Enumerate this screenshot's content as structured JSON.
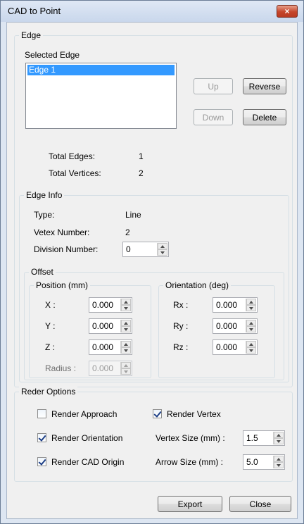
{
  "window": {
    "title": "CAD to Point",
    "close_label": "×"
  },
  "edge_group": {
    "label": "Edge",
    "selected_edge_label": "Selected Edge",
    "edges": [
      "Edge 1"
    ],
    "buttons": {
      "up": "Up",
      "reverse": "Reverse",
      "down": "Down",
      "delete": "Delete"
    },
    "total_edges_label": "Total Edges:",
    "total_edges_value": "1",
    "total_vertices_label": "Total Vertices:",
    "total_vertices_value": "2"
  },
  "edge_info": {
    "label": "Edge Info",
    "type_label": "Type:",
    "type_value": "Line",
    "vertex_number_label": "Vetex Number:",
    "vertex_number_value": "2",
    "division_number_label": "Division Number:",
    "division_number_value": "0"
  },
  "offset": {
    "label": "Offset",
    "position": {
      "label": "Position (mm)",
      "x_label": "X :",
      "x_value": "0.000",
      "y_label": "Y :",
      "y_value": "0.000",
      "z_label": "Z :",
      "z_value": "0.000",
      "radius_label": "Radius :",
      "radius_value": "0.000"
    },
    "orientation": {
      "label": "Orientation (deg)",
      "rx_label": "Rx :",
      "rx_value": "0.000",
      "ry_label": "Ry :",
      "ry_value": "0.000",
      "rz_label": "Rz :",
      "rz_value": "0.000"
    }
  },
  "render_options": {
    "label": "Reder Options",
    "render_approach": {
      "label": "Render Approach",
      "checked": false
    },
    "render_vertex": {
      "label": "Render Vertex",
      "checked": true
    },
    "render_orientation": {
      "label": "Render Orientation",
      "checked": true
    },
    "render_cad_origin": {
      "label": "Render CAD Origin",
      "checked": true
    },
    "vertex_size_label": "Vertex Size (mm) :",
    "vertex_size_value": "1.5",
    "arrow_size_label": "Arrow Size (mm) :",
    "arrow_size_value": "5.0"
  },
  "footer": {
    "export": "Export",
    "close": "Close"
  }
}
